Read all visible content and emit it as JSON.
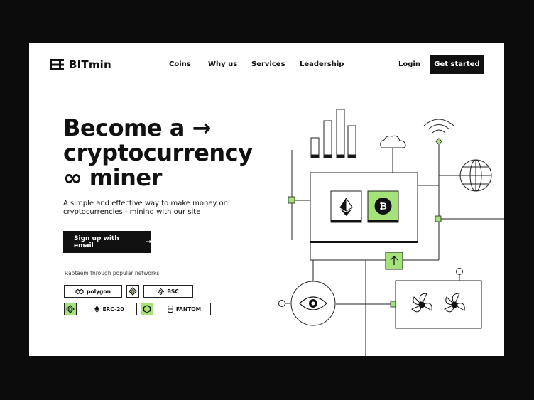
{
  "brand": {
    "name": "BITmin",
    "logo_icon": "stacked-bars-logo-icon"
  },
  "nav": {
    "items": [
      "Coins",
      "Why us",
      "Services",
      "Leadership"
    ]
  },
  "header": {
    "login_label": "Login",
    "cta_label": "Get started"
  },
  "hero": {
    "line1": "Become a",
    "line2": "cryptocurrency",
    "line3": "miner",
    "arrow_glyph": "→",
    "infinity_glyph": "∞",
    "subtitle": "A simple and effective way to make money on cryptocurrencies - mining with our site",
    "signup_label": "Sign up with email",
    "signup_arrow": "→"
  },
  "networks": {
    "title": "Raotaem through popular networks",
    "items": [
      "polygon",
      "BSC",
      "ERC-20",
      "FANTOM"
    ]
  },
  "colors": {
    "accent": "#a5e27a",
    "dark": "#111111",
    "background": "#ffffff",
    "frame": "#0c0c0c"
  }
}
